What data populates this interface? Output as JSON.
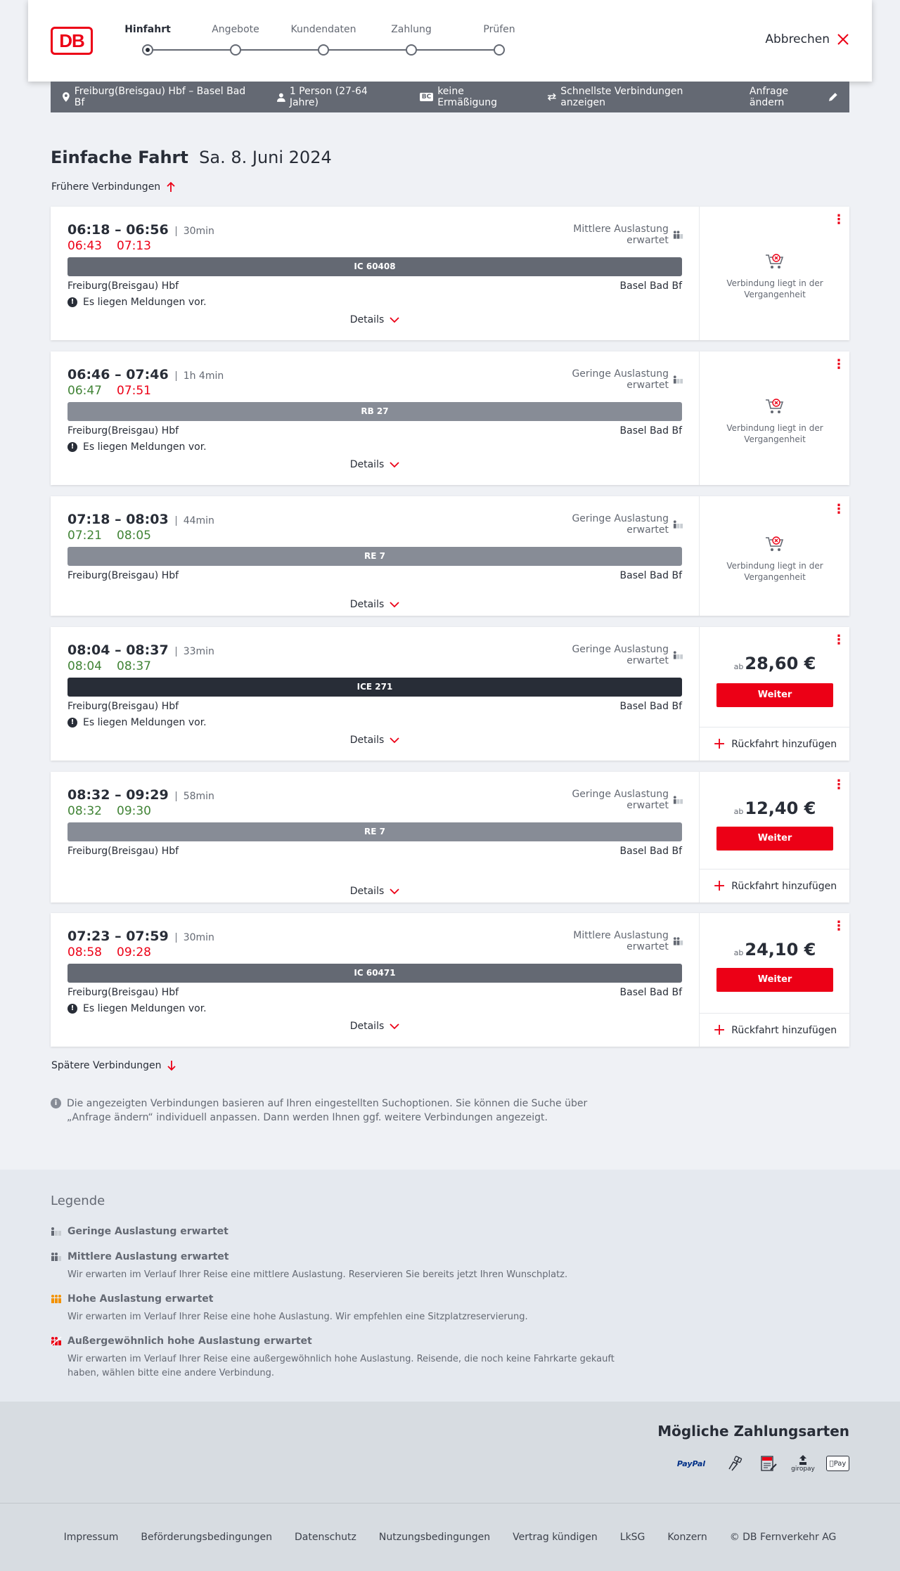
{
  "header": {
    "logo": "DB",
    "steps": [
      "Hinfahrt",
      "Angebote",
      "Kundendaten",
      "Zahlung",
      "Prüfen"
    ],
    "active_step": 0,
    "cancel": "Abbrechen"
  },
  "query": {
    "route": "Freiburg(Breisgau) Hbf – Basel Bad Bf",
    "persons": "1 Person (27-64 Jahre)",
    "bc_icon": "BC",
    "discount": "keine Ermäßigung",
    "fastest": "Schnellste Verbindungen anzeigen",
    "change": "Anfrage ändern"
  },
  "page": {
    "title": "Einfache Fahrt",
    "date": "Sa. 8. Juni 2024",
    "earlier": "Frühere Verbindungen",
    "later": "Spätere Verbindungen"
  },
  "labels": {
    "details": "Details",
    "past": "Verbindung liegt in der Vergangenheit",
    "weiter": "Weiter",
    "return": "Rückfahrt hinzufügen",
    "ab": "ab",
    "messages": "Es liegen Meldungen vor."
  },
  "connections": [
    {
      "times": "06:18 – 06:56",
      "duration": "30min",
      "rt_dep": "06:43",
      "rt_arr": "07:13",
      "rt_color": "red",
      "load": "Mittlere Auslastung erwartet",
      "train": "IC 60408",
      "from": "Freiburg(Breisgau) Hbf",
      "to": "Basel Bad Bf",
      "messages": true,
      "status": "past"
    },
    {
      "times": "06:46 – 07:46",
      "duration": "1h 4min",
      "rt_dep": "06:47",
      "rt_arr": "07:51",
      "rt_color": "mixed",
      "load": "Geringe Auslastung erwartet",
      "train": "RB 27",
      "from": "Freiburg(Breisgau) Hbf",
      "to": "Basel Bad Bf",
      "messages": true,
      "status": "past"
    },
    {
      "times": "07:18 – 08:03",
      "duration": "44min",
      "rt_dep": "07:21",
      "rt_arr": "08:05",
      "rt_color": "green",
      "load": "Geringe Auslastung erwartet",
      "train": "RE 7",
      "from": "Freiburg(Breisgau) Hbf",
      "to": "Basel Bad Bf",
      "messages": false,
      "status": "past"
    },
    {
      "times": "08:04 – 08:37",
      "duration": "33min",
      "rt_dep": "08:04",
      "rt_arr": "08:37",
      "rt_color": "green",
      "load": "Geringe Auslastung erwartet",
      "train": "ICE 271",
      "from": "Freiburg(Breisgau) Hbf",
      "to": "Basel Bad Bf",
      "messages": true,
      "status": "bookable",
      "price": "28,60 €"
    },
    {
      "times": "08:32 – 09:29",
      "duration": "58min",
      "rt_dep": "08:32",
      "rt_arr": "09:30",
      "rt_color": "green",
      "load": "Geringe Auslastung erwartet",
      "train": "RE 7",
      "from": "Freiburg(Breisgau) Hbf",
      "to": "Basel Bad Bf",
      "messages": false,
      "status": "bookable",
      "price": "12,40 €"
    },
    {
      "times": "07:23 – 07:59",
      "duration": "30min",
      "rt_dep": "08:58",
      "rt_arr": "09:28",
      "rt_color": "red",
      "load": "Mittlere Auslastung erwartet",
      "train": "IC 60471",
      "from": "Freiburg(Breisgau) Hbf",
      "to": "Basel Bad Bf",
      "messages": true,
      "status": "bookable",
      "price": "24,10 €"
    }
  ],
  "info": "Die angezeigten Verbindungen basieren auf Ihren eingestellten Suchoptionen. Sie können die Suche über „Anfrage ändern“ individuell anpassen. Dann werden Ihnen ggf. weitere Verbindungen angezeigt.",
  "legend": {
    "title": "Legende",
    "items": [
      {
        "title": "Geringe Auslastung erwartet",
        "desc": ""
      },
      {
        "title": "Mittlere Auslastung erwartet",
        "desc": "Wir erwarten im Verlauf Ihrer Reise eine mittlere Auslastung. Reservieren Sie bereits jetzt Ihren Wunschplatz."
      },
      {
        "title": "Hohe Auslastung erwartet",
        "desc": "Wir erwarten im Verlauf Ihrer Reise eine hohe Auslastung. Wir empfehlen eine Sitzplatzreservierung."
      },
      {
        "title": "Außergewöhnlich hohe Auslastung erwartet",
        "desc": "Wir erwarten im Verlauf Ihrer Reise eine außergewöhnlich hohe Auslastung. Reisende, die noch keine Fahrkarte gekauft haben, wählen bitte eine andere Verbindung."
      }
    ]
  },
  "payment": {
    "title": "Mögliche Zahlungsarten",
    "paypal": "PayPal",
    "sepa": "SEPA",
    "giropay": "giropay",
    "applepay": "Pay"
  },
  "footer": [
    "Impressum",
    "Beförderungsbedingungen",
    "Datenschutz",
    "Nutzungsbedingungen",
    "Vertrag kündigen",
    "LkSG",
    "Konzern",
    "© DB Fernverkehr AG"
  ],
  "colors": {
    "red": "#ec0016",
    "green": "#408335",
    "dark": "#282d37",
    "grey": "#646973"
  }
}
